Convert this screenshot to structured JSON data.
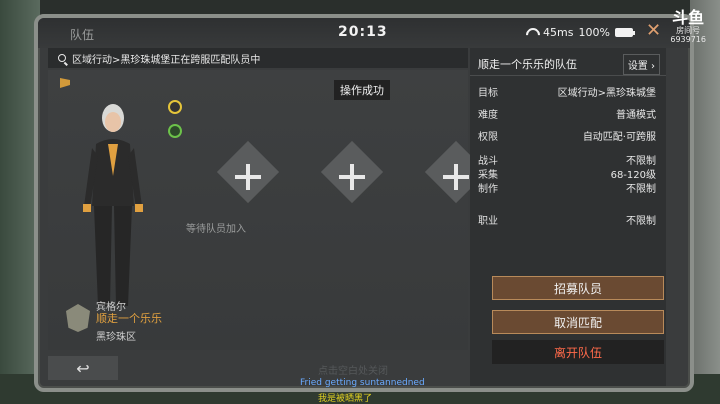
{
  "window": {
    "title": "队伍",
    "clock": "20:13",
    "ping": "45ms",
    "battery": "100%"
  },
  "search_status": "区域行动>黑珍珠城堡正在跨服匹配队员中",
  "toast": "操作成功",
  "slots": {
    "waiting_label": "等待队员加入"
  },
  "player": {
    "name": "宾格尔",
    "team_name": "顺走一个乐乐",
    "zone": "黑珍珠区"
  },
  "team_panel": {
    "title": "顺走一个乐乐的队伍",
    "settings_label": "设置",
    "rows": [
      {
        "k": "目标",
        "v": "区域行动>黑珍珠城堡"
      },
      {
        "k": "难度",
        "v": "普通模式"
      },
      {
        "k": "权限",
        "v": "自动匹配·可跨服"
      },
      {
        "k": "战斗",
        "v": "不限制"
      },
      {
        "k": "采集",
        "v": "68-120级"
      },
      {
        "k": "制作",
        "v": "不限制"
      },
      {
        "k": "职业",
        "v": "不限制"
      }
    ],
    "recruit_label": "招募队员",
    "cancel_label": "取消匹配",
    "leave_label": "离开队伍"
  },
  "hint": "点击空白处关闭",
  "logo": {
    "brand": "斗鱼",
    "sub": "房间号",
    "room": "6939716"
  },
  "subtitles": [
    "Fried getting suntannedned",
    "我是被晒黑了"
  ],
  "colors": {
    "accent": "#e0a040",
    "button": "#6a4a32",
    "leave": "#ff6a4a"
  }
}
